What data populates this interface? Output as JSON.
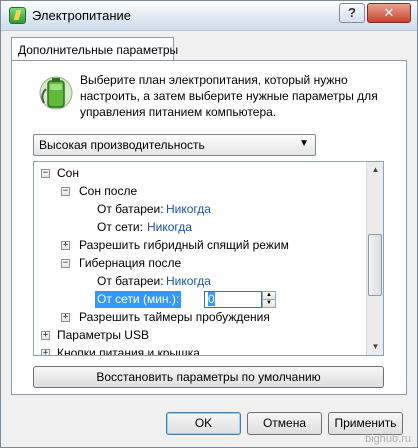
{
  "window": {
    "title": "Электропитание",
    "help_label": "?",
    "close_label": "✕"
  },
  "tab": {
    "label": "Дополнительные параметры"
  },
  "intro_text": "Выберите план электропитания, который нужно настроить, а затем выберите нужные параметры для управления питанием компьютера.",
  "plan_select": {
    "value": "Высокая производительность",
    "arrow": "▼"
  },
  "tree": {
    "sleep": {
      "expander": "−",
      "label": "Сон"
    },
    "sleep_after": {
      "expander": "−",
      "label": "Сон после",
      "battery_label": "От батареи:",
      "battery_value": "Никогда",
      "ac_label": "От сети:",
      "ac_value": "Никогда"
    },
    "hybrid_sleep": {
      "expander": "+",
      "label": "Разрешить гибридный спящий режим"
    },
    "hibernate_after": {
      "expander": "−",
      "label": "Гибернация после",
      "battery_label": "От батареи:",
      "battery_value": "Никогда",
      "ac_label": "От сети (мин.):",
      "ac_value": "0"
    },
    "wake_timers": {
      "expander": "+",
      "label": "Разрешить таймеры пробуждения"
    },
    "usb": {
      "expander": "+",
      "label": "Параметры USB"
    },
    "power_buttons": {
      "expander": "+",
      "label": "Кнопки питания и крышка"
    }
  },
  "scrollbar": {
    "up": "▲",
    "down": "▼"
  },
  "spinner": {
    "up": "▲",
    "down": "▼"
  },
  "buttons": {
    "restore": "Восстановить параметры по умолчанию",
    "ok": "OK",
    "cancel": "Отмена",
    "apply": "Применить"
  },
  "watermark": "bighub.ru",
  "colors": {
    "link": "#1c51a8",
    "selection": "#3399ff"
  }
}
